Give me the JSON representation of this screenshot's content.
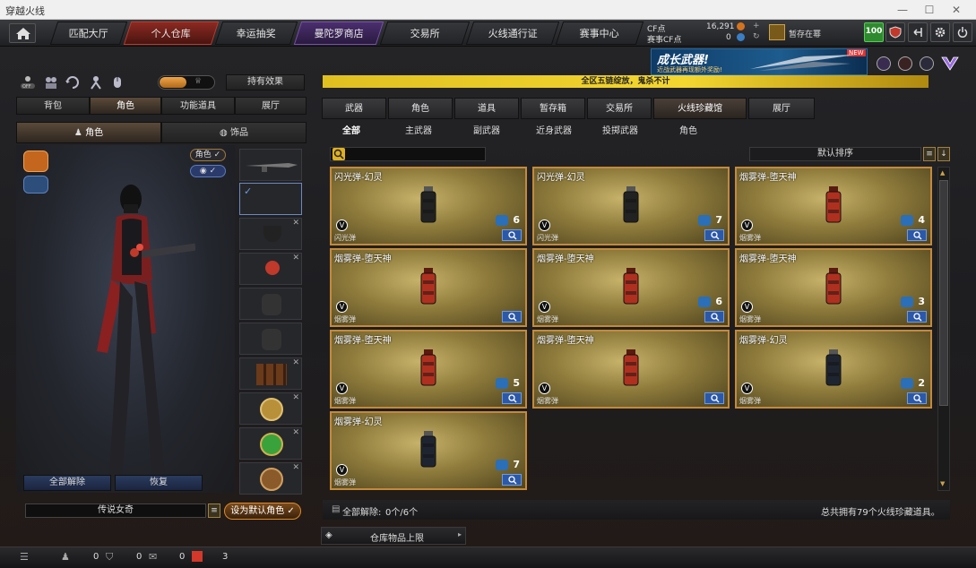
{
  "window": {
    "title": "穿越火线"
  },
  "nav": {
    "tabs": [
      {
        "label": "匹配大厅"
      },
      {
        "label": "个人仓库"
      },
      {
        "label": "幸运抽奖"
      },
      {
        "label": "曼陀罗商店"
      },
      {
        "label": "交易所"
      },
      {
        "label": "火线通行证"
      },
      {
        "label": "赛事中心"
      }
    ],
    "cf_label": "CF点",
    "cf_value": "16,291",
    "match_cf_label": "赛事CF点",
    "match_cf_value": "0",
    "guild_status": "暂存在幂",
    "level_badge": "100"
  },
  "left": {
    "toggle_label": "持有效果",
    "main_tabs": [
      "背包",
      "角色",
      "功能道具",
      "展厅"
    ],
    "sub_tabs": [
      "角色",
      "饰品"
    ],
    "role_tag": "角色",
    "btn_unequip_all": "全部解除",
    "btn_restore": "恢复",
    "character_name": "传说女奇",
    "btn_set_default": "设为默认角色"
  },
  "banner": {
    "ticker": "全区五链绽放，鬼杀不计",
    "ad_title": "成长武器!",
    "ad_sub": "近战武器再现额外奖励!",
    "ad_new": "NEW"
  },
  "right": {
    "main_tabs": [
      "武器",
      "角色",
      "道具",
      "暂存箱",
      "交易所",
      "火线珍藏馆",
      "展厅"
    ],
    "sub_tabs": [
      "全部",
      "主武器",
      "副武器",
      "近身武器",
      "投掷武器",
      "角色"
    ],
    "sort_label": "默认排序",
    "cards": [
      {
        "name": "闪光弹-幻灵",
        "type": "闪光弹",
        "count": "6",
        "kind": "flash"
      },
      {
        "name": "闪光弹-幻灵",
        "type": "闪光弹",
        "count": "7",
        "kind": "flash"
      },
      {
        "name": "烟雾弹-堕天神",
        "type": "烟雾弹",
        "count": "4",
        "kind": "smoke"
      },
      {
        "name": "烟雾弹-堕天神",
        "type": "烟雾弹",
        "count": "",
        "kind": "smoke"
      },
      {
        "name": "烟雾弹-堕天神",
        "type": "烟雾弹",
        "count": "6",
        "kind": "smoke"
      },
      {
        "name": "烟雾弹-堕天神",
        "type": "烟雾弹",
        "count": "3",
        "kind": "smoke"
      },
      {
        "name": "烟雾弹-堕天神",
        "type": "烟雾弹",
        "count": "5",
        "kind": "smoke"
      },
      {
        "name": "烟雾弹-堕天神",
        "type": "烟雾弹",
        "count": "",
        "kind": "smoke"
      },
      {
        "name": "烟雾弹-幻灵",
        "type": "烟雾弹",
        "count": "2",
        "kind": "dark"
      },
      {
        "name": "烟雾弹-幻灵",
        "type": "烟雾弹",
        "count": "7",
        "kind": "dark"
      }
    ],
    "footer_unequip": "全部解除:",
    "footer_count": "0个/6个",
    "footer_total": "总共拥有79个火线珍藏道具。",
    "storage_limit": "仓库物品上限"
  },
  "bottom": {
    "c1": "0",
    "c2": "0",
    "c3": "0",
    "c4": "3"
  }
}
